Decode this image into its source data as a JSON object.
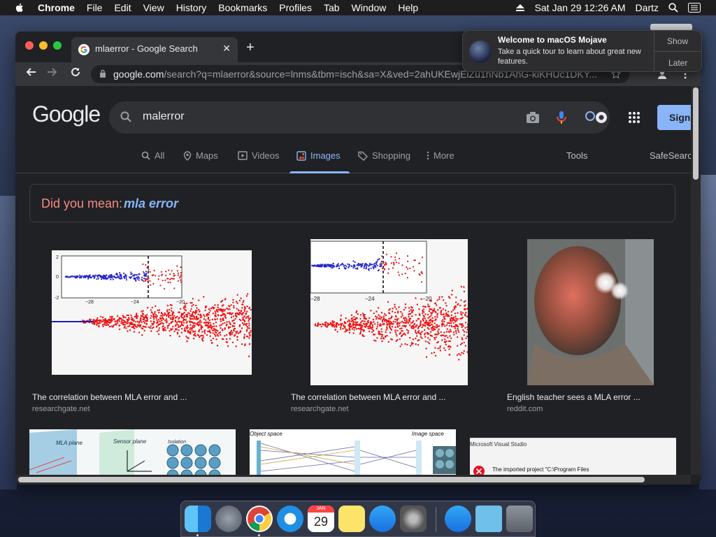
{
  "menubar": {
    "app": "Chrome",
    "items": [
      "File",
      "Edit",
      "View",
      "History",
      "Bookmarks",
      "Profiles",
      "Tab",
      "Window",
      "Help"
    ],
    "clock": "Sat Jan 29  12:26 AM",
    "user": "Dartz"
  },
  "browser": {
    "tab_title": "mlaerror - Google Search",
    "url_host": "google.com",
    "url_path": "/search?q=mlaerror&source=lnms&tbm=isch&sa=X&ved=2ahUKEwjEiZu1hNb1AhG-kiKHUc1DKY..."
  },
  "google": {
    "logo": "Google",
    "query": "malerror",
    "sign_in": "Sign",
    "tabs": [
      {
        "label": "All",
        "icon": "search-icon"
      },
      {
        "label": "Maps",
        "icon": "map-pin-icon"
      },
      {
        "label": "Videos",
        "icon": "video-icon"
      },
      {
        "label": "Images",
        "icon": "image-icon"
      },
      {
        "label": "Shopping",
        "icon": "tag-icon"
      },
      {
        "label": "More",
        "icon": "more-vert-icon"
      }
    ],
    "tools": "Tools",
    "safesearch": "SafeSearch",
    "did_you_mean_label": "Did you mean:",
    "did_you_mean_query": "mla error",
    "results": [
      {
        "title": "The correlation between MLA error and ...",
        "source": "researchgate.net"
      },
      {
        "title": "The correlation between MLA error and ...",
        "source": "researchgate.net"
      },
      {
        "title": "English teacher sees a MLA error ...",
        "source": "reddit.com"
      }
    ],
    "row2_texts": {
      "r4_a": "MLA plane",
      "r4_b": "Sensor plane",
      "r4_c": "Isolation",
      "r5_a": "Object space",
      "r5_b": "Image space",
      "r6_a": "Microsoft Visual Studio",
      "r6_b": "The imported project \"C:\\Program Files"
    },
    "chart_ticks": {
      "y_top": "2",
      "y_mid": "0",
      "y_bot": "-2",
      "x1": "−28",
      "x2": "−24",
      "x3": "−20"
    }
  },
  "notification": {
    "title": "Welcome to macOS Mojave",
    "body": "Take a quick tour to learn about great new features.",
    "show": "Show",
    "later": "Later"
  },
  "dock": {
    "calendar_month": "JAN",
    "calendar_day": "29"
  }
}
